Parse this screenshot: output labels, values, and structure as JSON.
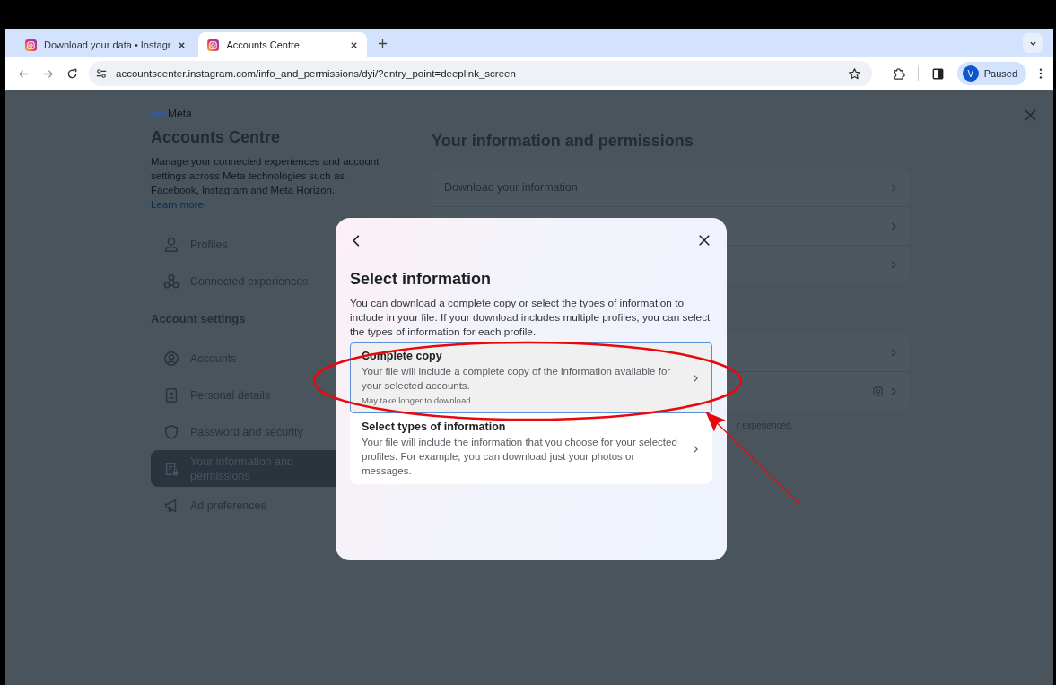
{
  "browser": {
    "tabs": [
      {
        "title": "Download your data • Instagr",
        "selected": false
      },
      {
        "title": "Accounts Centre",
        "selected": true
      }
    ],
    "url": "accountscenter.instagram.com/info_and_permissions/dyi/?entry_point=deeplink_screen",
    "profile": {
      "initial": "V",
      "status": "Paused"
    }
  },
  "sidebar": {
    "brand": "Meta",
    "title": "Accounts Centre",
    "description": "Manage your connected experiences and account settings across Meta technologies such as Facebook, Instagram and Meta Horizon.",
    "learn_more": "Learn more",
    "items": [
      {
        "label": "Profiles",
        "kind": "person",
        "selected": false
      },
      {
        "label": "Connected experiences",
        "kind": "nodes",
        "selected": false
      }
    ],
    "section": "Account settings",
    "settings_items": [
      {
        "label": "Accounts",
        "kind": "account",
        "selected": false
      },
      {
        "label": "Personal details",
        "kind": "card",
        "selected": false
      },
      {
        "label": "Password and security",
        "kind": "shield",
        "selected": false
      },
      {
        "label": "Your information and permissions",
        "kind": "doc",
        "selected": true
      },
      {
        "label": "Ad preferences",
        "kind": "megaphone",
        "selected": false
      }
    ]
  },
  "main": {
    "title": "Your information and permissions",
    "groups": [
      {
        "rows": [
          {
            "label": "Download your information",
            "kind": "plain"
          },
          {
            "kind": "plain"
          },
          {
            "kind": "plain"
          }
        ]
      },
      {
        "rows": [
          {
            "kind": "plain"
          },
          {
            "kind": "instagram"
          }
        ]
      }
    ],
    "footer": "r experiences."
  },
  "modal": {
    "title": "Select information",
    "description": "You can download a complete copy or select the types of information to include in your file. If your download includes multiple profiles, you can select the types of information for each profile.",
    "options": [
      {
        "title": "Complete copy",
        "description": "Your file will include a complete copy of the information available for your selected accounts.",
        "note": "May take longer to download",
        "selected": true
      },
      {
        "title": "Select types of information",
        "description": "Your file will include the information that you choose for your selected profiles. For example, you can download just your photos or messages.",
        "selected": false
      }
    ]
  }
}
